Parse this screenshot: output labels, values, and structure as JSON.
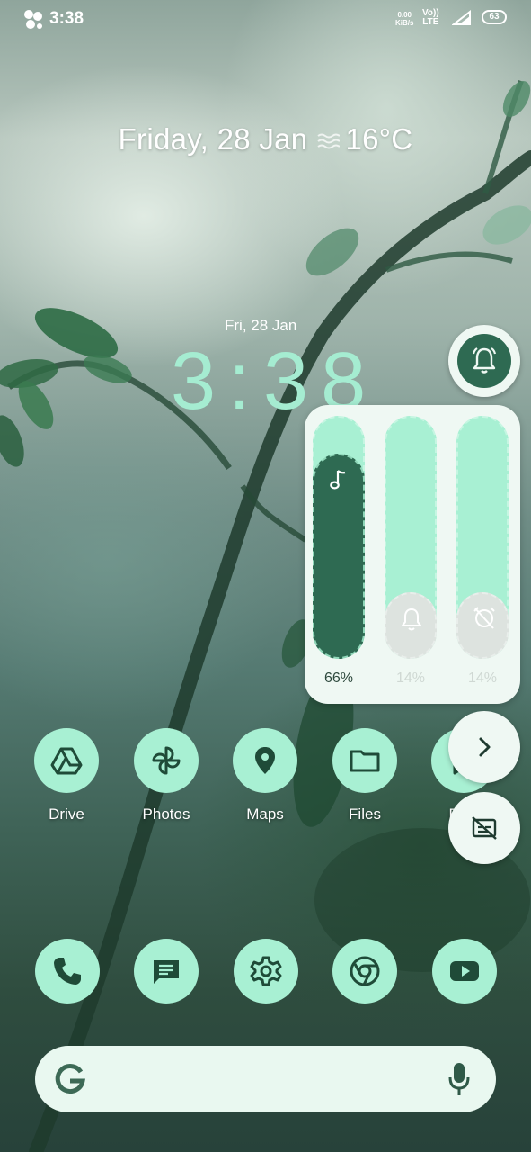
{
  "status_bar": {
    "time": "3:38",
    "net_speed_value": "0.00",
    "net_speed_unit": "KiB/s",
    "volte": "Vo))",
    "lte": "LTE",
    "battery": "63"
  },
  "date_weather": {
    "date": "Friday, 28 Jan",
    "temperature": "16°C",
    "weather_icon": "fog-icon"
  },
  "clock_widget": {
    "date": "Fri, 28 Jan",
    "time": "3:38"
  },
  "volume_panel": {
    "ring_button_icon": "bell-icon",
    "sliders": [
      {
        "name": "media",
        "icon": "music-note-icon",
        "level": 0.66,
        "label": "66%"
      },
      {
        "name": "ring",
        "icon": "bell-icon",
        "level": 0.14,
        "label": "14%"
      },
      {
        "name": "alarm",
        "icon": "alarm-off-icon",
        "level": 0.14,
        "label": "14%"
      }
    ],
    "expand_icon": "chevron-right-icon",
    "captions_icon": "captions-off-icon"
  },
  "apps": [
    {
      "label": "Drive",
      "icon": "drive-icon"
    },
    {
      "label": "Photos",
      "icon": "pinwheel-icon"
    },
    {
      "label": "Maps",
      "icon": "map-pin-icon"
    },
    {
      "label": "Files",
      "icon": "folder-icon"
    },
    {
      "label": "Play",
      "icon": "play-store-icon"
    }
  ],
  "dock": [
    {
      "icon": "phone-icon"
    },
    {
      "icon": "messages-icon"
    },
    {
      "icon": "settings-icon"
    },
    {
      "icon": "chrome-icon"
    },
    {
      "icon": "youtube-icon"
    }
  ],
  "search_bar": {
    "logo": "G",
    "mic_icon": "mic-icon"
  },
  "colors": {
    "accent": "#a8f0d3",
    "accent_dark": "#2e6a52",
    "panel_bg": "#eff8f3",
    "muted": "#dde3df"
  }
}
